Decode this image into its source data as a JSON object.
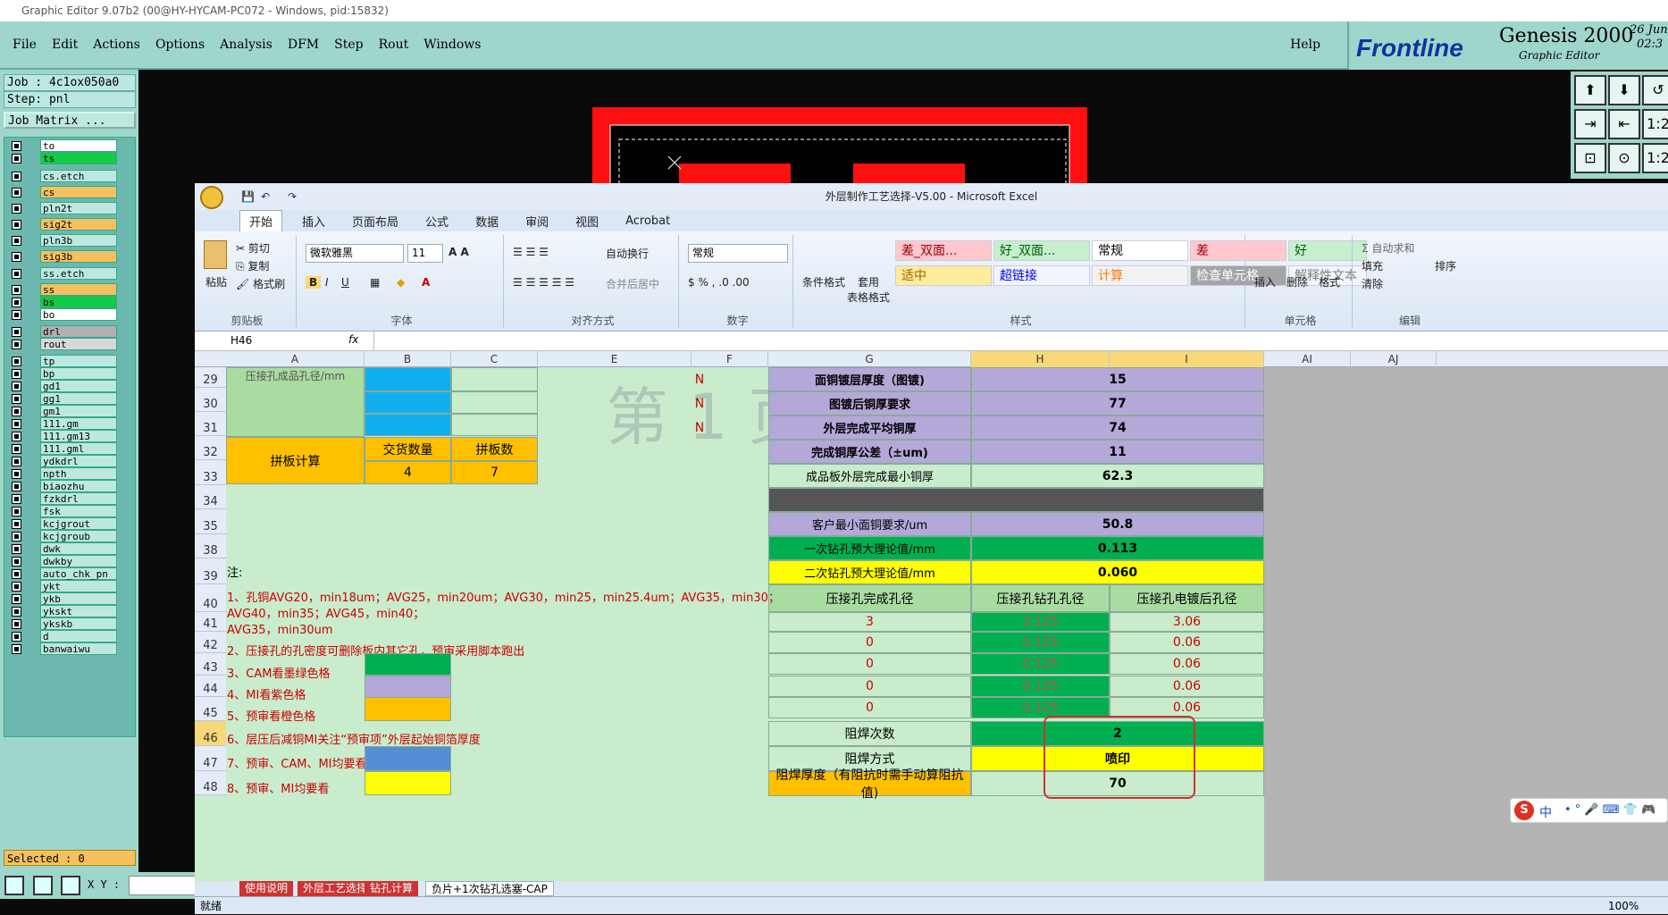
{
  "title_bar": {
    "text": "Graphic Editor 9.07b2 (00@HY-HYCAM-PC072 - Windows, pid:15832)"
  },
  "menu": {
    "items": [
      "File",
      "Edit",
      "Actions",
      "Options",
      "Analysis",
      "DFM",
      "Step",
      "Rout",
      "Windows"
    ],
    "help": "Help"
  },
  "brand": {
    "logo": "Frontline",
    "product": "Genesis 2000",
    "sub": "Graphic Editor",
    "date": "26 Jun",
    "time": "02:3"
  },
  "job": {
    "job_line": "Job : 4c1ox050a0",
    "step_line": "Step: pnl",
    "matrix_button": "Job Matrix ...",
    "selected": "Selected : 0"
  },
  "layers": [
    {
      "name": "to",
      "color": "#ffffff"
    },
    {
      "name": "ts",
      "color": "#11cc44"
    },
    {
      "name": "cs.etch",
      "color": "#bde8e0"
    },
    {
      "name": "cs",
      "color": "#f4c060"
    },
    {
      "name": "pln2t",
      "color": "#bde8e0"
    },
    {
      "name": "sig2t",
      "color": "#f4c060"
    },
    {
      "name": "pln3b",
      "color": "#bde8e0"
    },
    {
      "name": "sig3b",
      "color": "#f4c060"
    },
    {
      "name": "ss.etch",
      "color": "#bde8e0"
    },
    {
      "name": "ss",
      "color": "#f4c060"
    },
    {
      "name": "bs",
      "color": "#11cc44"
    },
    {
      "name": "bo",
      "color": "#ffffff"
    },
    {
      "name": "drl",
      "color": "#b0b0b0"
    },
    {
      "name": "rout",
      "color": "#d8d8d8"
    },
    {
      "name": "tp",
      "color": "#bde8e0"
    },
    {
      "name": "bp",
      "color": "#bde8e0"
    },
    {
      "name": "gd1",
      "color": "#bde8e0"
    },
    {
      "name": "gg1",
      "color": "#bde8e0"
    },
    {
      "name": "gm1",
      "color": "#bde8e0"
    },
    {
      "name": "111.gm",
      "color": "#bde8e0"
    },
    {
      "name": "111.gm13",
      "color": "#bde8e0"
    },
    {
      "name": "111.gml",
      "color": "#bde8e0"
    },
    {
      "name": "ydkdrl",
      "color": "#bde8e0"
    },
    {
      "name": "npth",
      "color": "#bde8e0"
    },
    {
      "name": "biaozhu",
      "color": "#bde8e0"
    },
    {
      "name": "fzkdrl",
      "color": "#bde8e0"
    },
    {
      "name": "fsk",
      "color": "#bde8e0"
    },
    {
      "name": "kcjgrout",
      "color": "#bde8e0"
    },
    {
      "name": "kcjgroub",
      "color": "#bde8e0"
    },
    {
      "name": "dwk",
      "color": "#bde8e0"
    },
    {
      "name": "dwkby",
      "color": "#bde8e0"
    },
    {
      "name": "auto_chk_pn",
      "color": "#bde8e0"
    },
    {
      "name": "ykt",
      "color": "#bde8e0"
    },
    {
      "name": "ykb",
      "color": "#bde8e0"
    },
    {
      "name": "ykskt",
      "color": "#bde8e0"
    },
    {
      "name": "ykskb",
      "color": "#bde8e0"
    },
    {
      "name": "d",
      "color": "#bde8e0"
    },
    {
      "name": "banwaiwu",
      "color": "#bde8e0"
    }
  ],
  "right_buttons": [
    "⬆",
    "⬇",
    "↺",
    "⇥",
    "⇤",
    "1:2",
    "⊡",
    "⊙",
    "1:2"
  ],
  "xy_label": "X Y :",
  "excel": {
    "title": "外层制作工艺选择-V5.00 - Microsoft Excel",
    "tabs": [
      "开始",
      "插入",
      "页面布局",
      "公式",
      "数据",
      "审阅",
      "视图",
      "Acrobat"
    ],
    "clipboard": {
      "paste": "粘贴",
      "cut": "剪切",
      "copy": "复制",
      "format_painter": "格式刷",
      "label": "剪贴板"
    },
    "font": {
      "name": "微软雅黑",
      "size": "11",
      "label": "字体"
    },
    "align": {
      "wrap": "自动换行",
      "merge": "合并后居中",
      "label": "对齐方式"
    },
    "number": {
      "format": "常规",
      "label": "数字"
    },
    "styles": {
      "conditional": "条件格式",
      "table": "套用\n表格格式",
      "label": "样式",
      "boxes": [
        {
          "t": "差_双面...",
          "bg": "#ffc7ce",
          "fg": "#9c0006"
        },
        {
          "t": "好_双面...",
          "bg": "#c6efce",
          "fg": "#006100"
        },
        {
          "t": "常规",
          "bg": "#ffffff",
          "fg": "#000000"
        },
        {
          "t": "差",
          "bg": "#ffc7ce",
          "fg": "#9c0006"
        },
        {
          "t": "好",
          "bg": "#c6efce",
          "fg": "#006100"
        },
        {
          "t": "适中",
          "bg": "#ffeb9c",
          "fg": "#9c6500"
        },
        {
          "t": "超链接",
          "bg": "#f1f6fc",
          "fg": "#0000ff"
        },
        {
          "t": "计算",
          "bg": "#f2f2f2",
          "fg": "#fa7d00"
        },
        {
          "t": "检查单元格",
          "bg": "#a5a5a5",
          "fg": "#ffffff"
        },
        {
          "t": "解释性文本",
          "bg": "#f1f6fc",
          "fg": "#7f7f7f"
        }
      ]
    },
    "cells_group": {
      "insert": "插入",
      "delete": "删除",
      "format": "格式",
      "label": "单元格"
    },
    "edit_group": {
      "autosum": "Σ 自动求和",
      "fill": "填充",
      "clear": "清除",
      "sort": "排序",
      "label": "编辑"
    },
    "name_box": "H46",
    "fx": "fx",
    "columns": [
      "A",
      "B",
      "C",
      "E",
      "F",
      "G",
      "H",
      "I",
      "AI",
      "AJ"
    ],
    "rows": {
      "headers": [
        "29",
        "30",
        "31",
        "32",
        "33",
        "34",
        "35",
        "38",
        "39",
        "40",
        "41",
        "42",
        "43",
        "44",
        "45",
        "46",
        "47",
        "48"
      ]
    },
    "left_table": {
      "partial_label": "压接孔成品孔径/mm",
      "calc_label": "拼板计算",
      "qty_label": "交货数量",
      "panel_label": "拼板数",
      "qty": "4",
      "panel": "7"
    },
    "n_marks": [
      "N",
      "N",
      "N"
    ],
    "watermark": "第 1 页",
    "right_table": [
      {
        "label": "面铜镀层厚度（图镀)",
        "value": "15"
      },
      {
        "label": "图镀后铜厚要求",
        "value": "77"
      },
      {
        "label": "外层完成平均铜厚",
        "value": "74"
      },
      {
        "label": "完成铜厚公差（±um)",
        "value": "11"
      },
      {
        "label": "成品板外层完成最小铜厚",
        "value": "62.3"
      },
      {
        "label": "客户最小面铜要求/um",
        "value": "50.8"
      },
      {
        "label": "一次钻孔预大理论值/mm",
        "value": "0.113"
      },
      {
        "label": "二次钻孔预大理论值/mm",
        "value": "0.060"
      }
    ],
    "press_header": [
      "压接孔完成孔径",
      "压接孔钻孔孔径",
      "压接孔电镀后孔径"
    ],
    "press_rows": [
      [
        "3",
        "3.125",
        "3.06"
      ],
      [
        "0",
        "0.125",
        "0.06"
      ],
      [
        "0",
        "0.125",
        "0.06"
      ],
      [
        "0",
        "0.125",
        "0.06"
      ],
      [
        "0",
        "0.125",
        "0.06"
      ]
    ],
    "solder": [
      {
        "label": "阻焊次数",
        "value": "2"
      },
      {
        "label": "阻焊方式",
        "value": "喷印"
      },
      {
        "label": "阻焊厚度（有阻抗时需手动算阻抗值)",
        "value": "70"
      }
    ],
    "notes": {
      "title": "注:",
      "n1a": "1、孔铜AVG20，min18um；AVG25，min20um；AVG30，min25，min25.4um；AVG35，min30；",
      "n1b": "AVG40，min35；AVG45，min40；",
      "n1c": "AVG35，min30um",
      "n2": "2、压接孔的孔密度可删除板内其它孔，预审采用脚本跑出",
      "n3": "3、CAM看墨绿色格",
      "n4": "4、MI看紫色格",
      "n5": "5、预审看橙色格",
      "n6": "6、层压后减铜MI关注“预审项”外层起始铜箔厚度",
      "n7": "7、预审、CAM、MI均要看",
      "n8": "8、预审、MI均要看"
    },
    "sheet_tabs": [
      "使用说明",
      "外层工艺选择",
      "钻孔计算",
      "负片+1次钻孔选塞-CAP"
    ],
    "status": "就绪",
    "zoom": "100%"
  },
  "ime": {
    "label": "中"
  }
}
